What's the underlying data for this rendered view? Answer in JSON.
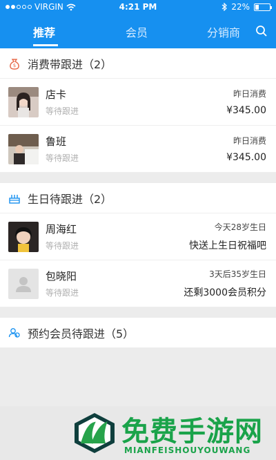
{
  "status_bar": {
    "carrier": "VIRGIN",
    "time": "4:21 PM",
    "battery": "22%"
  },
  "nav": {
    "tabs": [
      {
        "label": "推荐"
      },
      {
        "label": "会员"
      },
      {
        "label": "分销商"
      }
    ]
  },
  "sections": [
    {
      "title": "消费带跟进（2）",
      "items": [
        {
          "name": "店卡",
          "status": "等待跟进",
          "line1": "昨日消费",
          "line2": "¥345.00"
        },
        {
          "name": "鲁班",
          "status": "等待跟进",
          "line1": "昨日消费",
          "line2": "¥345.00"
        }
      ]
    },
    {
      "title": "生日待跟进（2）",
      "items": [
        {
          "name": "周海红",
          "status": "等待跟进",
          "line1": "今天28岁生日",
          "line2": "快送上生日祝福吧"
        },
        {
          "name": "包晓阳",
          "status": "等待跟进",
          "line1": "3天后35岁生日",
          "line2": "还剩3000会员积分"
        }
      ]
    },
    {
      "title": "预约会员待跟进（5）"
    }
  ],
  "banner": {
    "title": "免费手游网",
    "subtitle": "MIANFEISHOUYOUWANG"
  },
  "colors": {
    "primary": "#1690f0",
    "banner_green": "#1aa34a"
  }
}
